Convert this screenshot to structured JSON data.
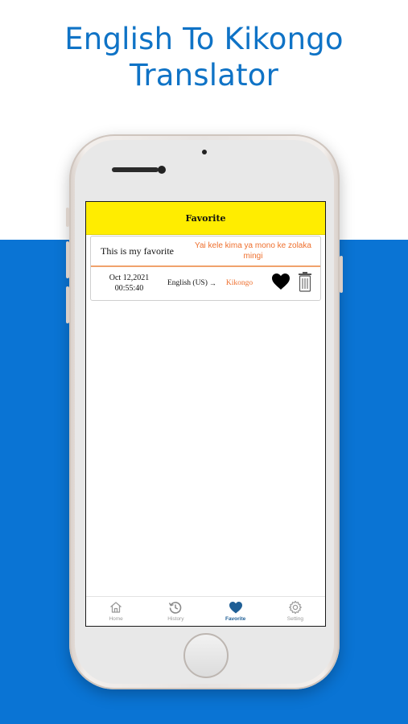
{
  "headline": {
    "line1": "English To Kikongo",
    "line2": "Translator"
  },
  "app": {
    "header_title": "Favorite",
    "favorite": {
      "source_text": "This is my favorite",
      "translated_text": "Yai kele kima ya mono ke zolaka mingi",
      "date": "Oct 12,2021",
      "time": "00:55:40",
      "source_lang": "English (US)",
      "arrow": "→",
      "target_lang": "Kikongo"
    },
    "tabs": [
      {
        "label": "Home",
        "icon": "home-icon"
      },
      {
        "label": "History",
        "icon": "history-icon"
      },
      {
        "label": "Favorite",
        "icon": "heart-icon"
      },
      {
        "label": "Setting",
        "icon": "gear-icon"
      }
    ],
    "active_tab": "Favorite"
  },
  "colors": {
    "brand_blue": "#0a74d4",
    "headline_blue": "#0f73c6",
    "header_yellow": "#ffed00",
    "accent_orange": "#ee6f2d",
    "active_tab": "#1f5f96"
  }
}
